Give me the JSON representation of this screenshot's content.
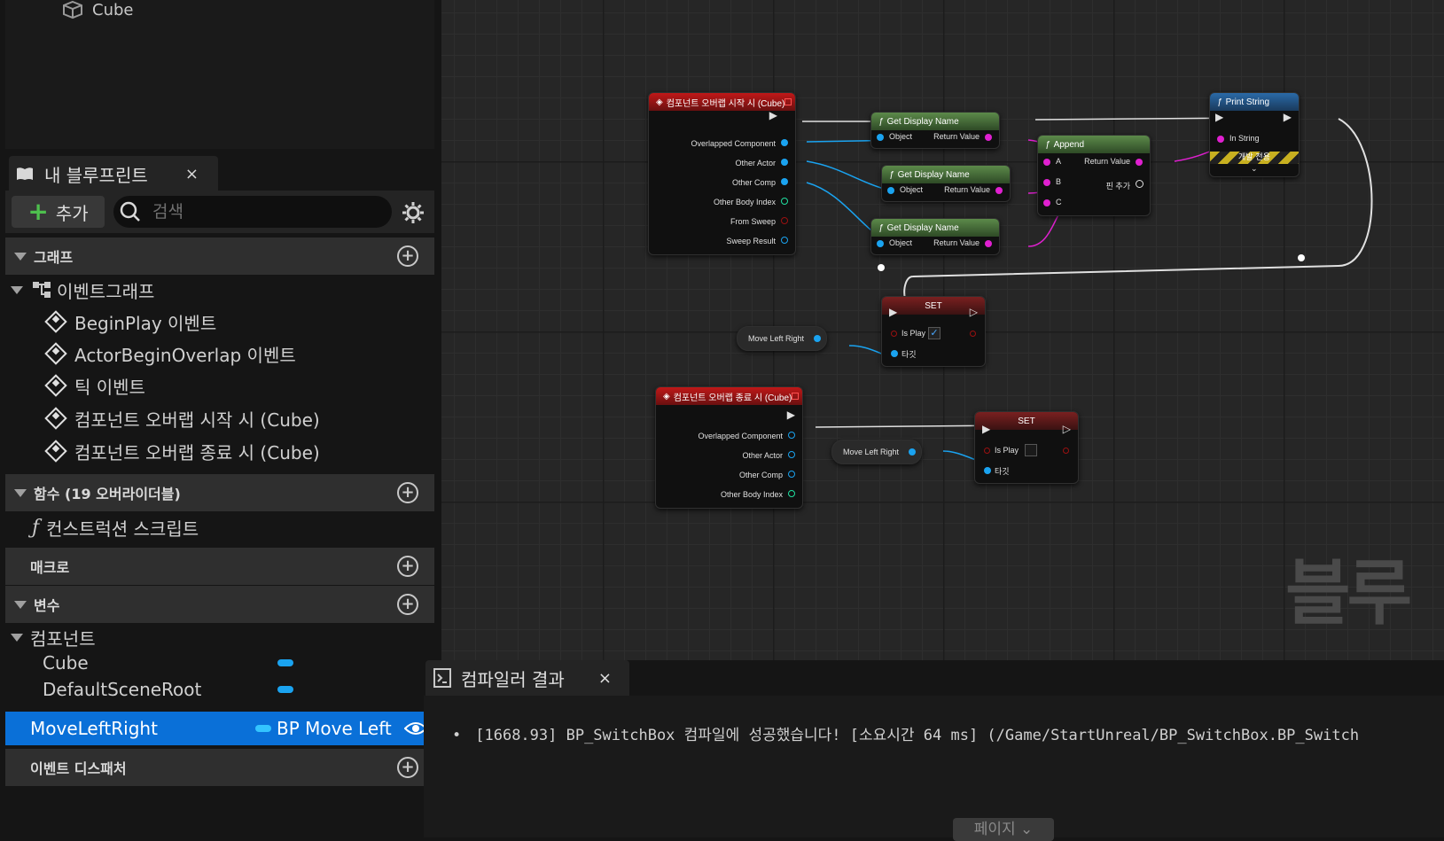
{
  "tree": {
    "item_label": "Cube"
  },
  "my_blueprint": {
    "tab_title": "내 블루프린트",
    "close": "×",
    "add_label": "추가",
    "search_placeholder": "검색",
    "sections": {
      "graph": "그래프",
      "functions": "함수 (19 오버라이더블)",
      "macros": "매크로",
      "variables": "변수",
      "dispatchers": "이벤트 디스패처"
    },
    "event_graph": "이벤트그래프",
    "events": [
      "BeginPlay 이벤트",
      "ActorBeginOverlap 이벤트",
      "틱 이벤트",
      "컴포넌트 오버랩 시작 시 (Cube)",
      "컴포넌트 오버랩 종료 시 (Cube)"
    ],
    "construction_script": "컨스트럭션 스크립트",
    "components_group": "컴포넌트",
    "components": [
      "Cube",
      "DefaultSceneRoot"
    ],
    "selected_var": {
      "name": "MoveLeftRight",
      "type": "BP Move Left F"
    }
  },
  "graph": {
    "node_begin": {
      "title": "컴포넌트 오버랩 시작 시 (Cube)",
      "pins": [
        "Overlapped Component",
        "Other Actor",
        "Other Comp",
        "Other Body Index",
        "From Sweep",
        "Sweep Result"
      ]
    },
    "get_display_name": {
      "title": "Get Display Name",
      "object": "Object",
      "ret": "Return Value"
    },
    "append": {
      "title": "Append",
      "a": "A",
      "b": "B",
      "c": "C",
      "ret": "Return Value",
      "add_pin": "핀 추가"
    },
    "print_string": {
      "title": "Print String",
      "in": "In String",
      "dev": "개발 전용"
    },
    "set": {
      "title": "SET",
      "is_play": "Is Play",
      "target": "타깃"
    },
    "var_node": "Move Left Right",
    "node_end": {
      "title": "컴포넌트 오버랩 종료 시 (Cube)",
      "pins": [
        "Overlapped Component",
        "Other Actor",
        "Other Comp",
        "Other Body Index"
      ]
    },
    "watermark": "블루"
  },
  "compiler": {
    "tab_title": "컴파일러 결과",
    "close": "×",
    "log": "[1668.93] BP_SwitchBox 컴파일에 성공했습니다! [소요시간 64 ms] (/Game/StartUnreal/BP_SwitchBox.BP_Switch",
    "page_button": "페이지 ⌄"
  },
  "colors": {
    "accent": "#0a70d8",
    "object_pin": "#1aa3f0",
    "string_pin": "#e020d0",
    "event_header": "#c01818",
    "function_header": "#5c8a4a"
  }
}
